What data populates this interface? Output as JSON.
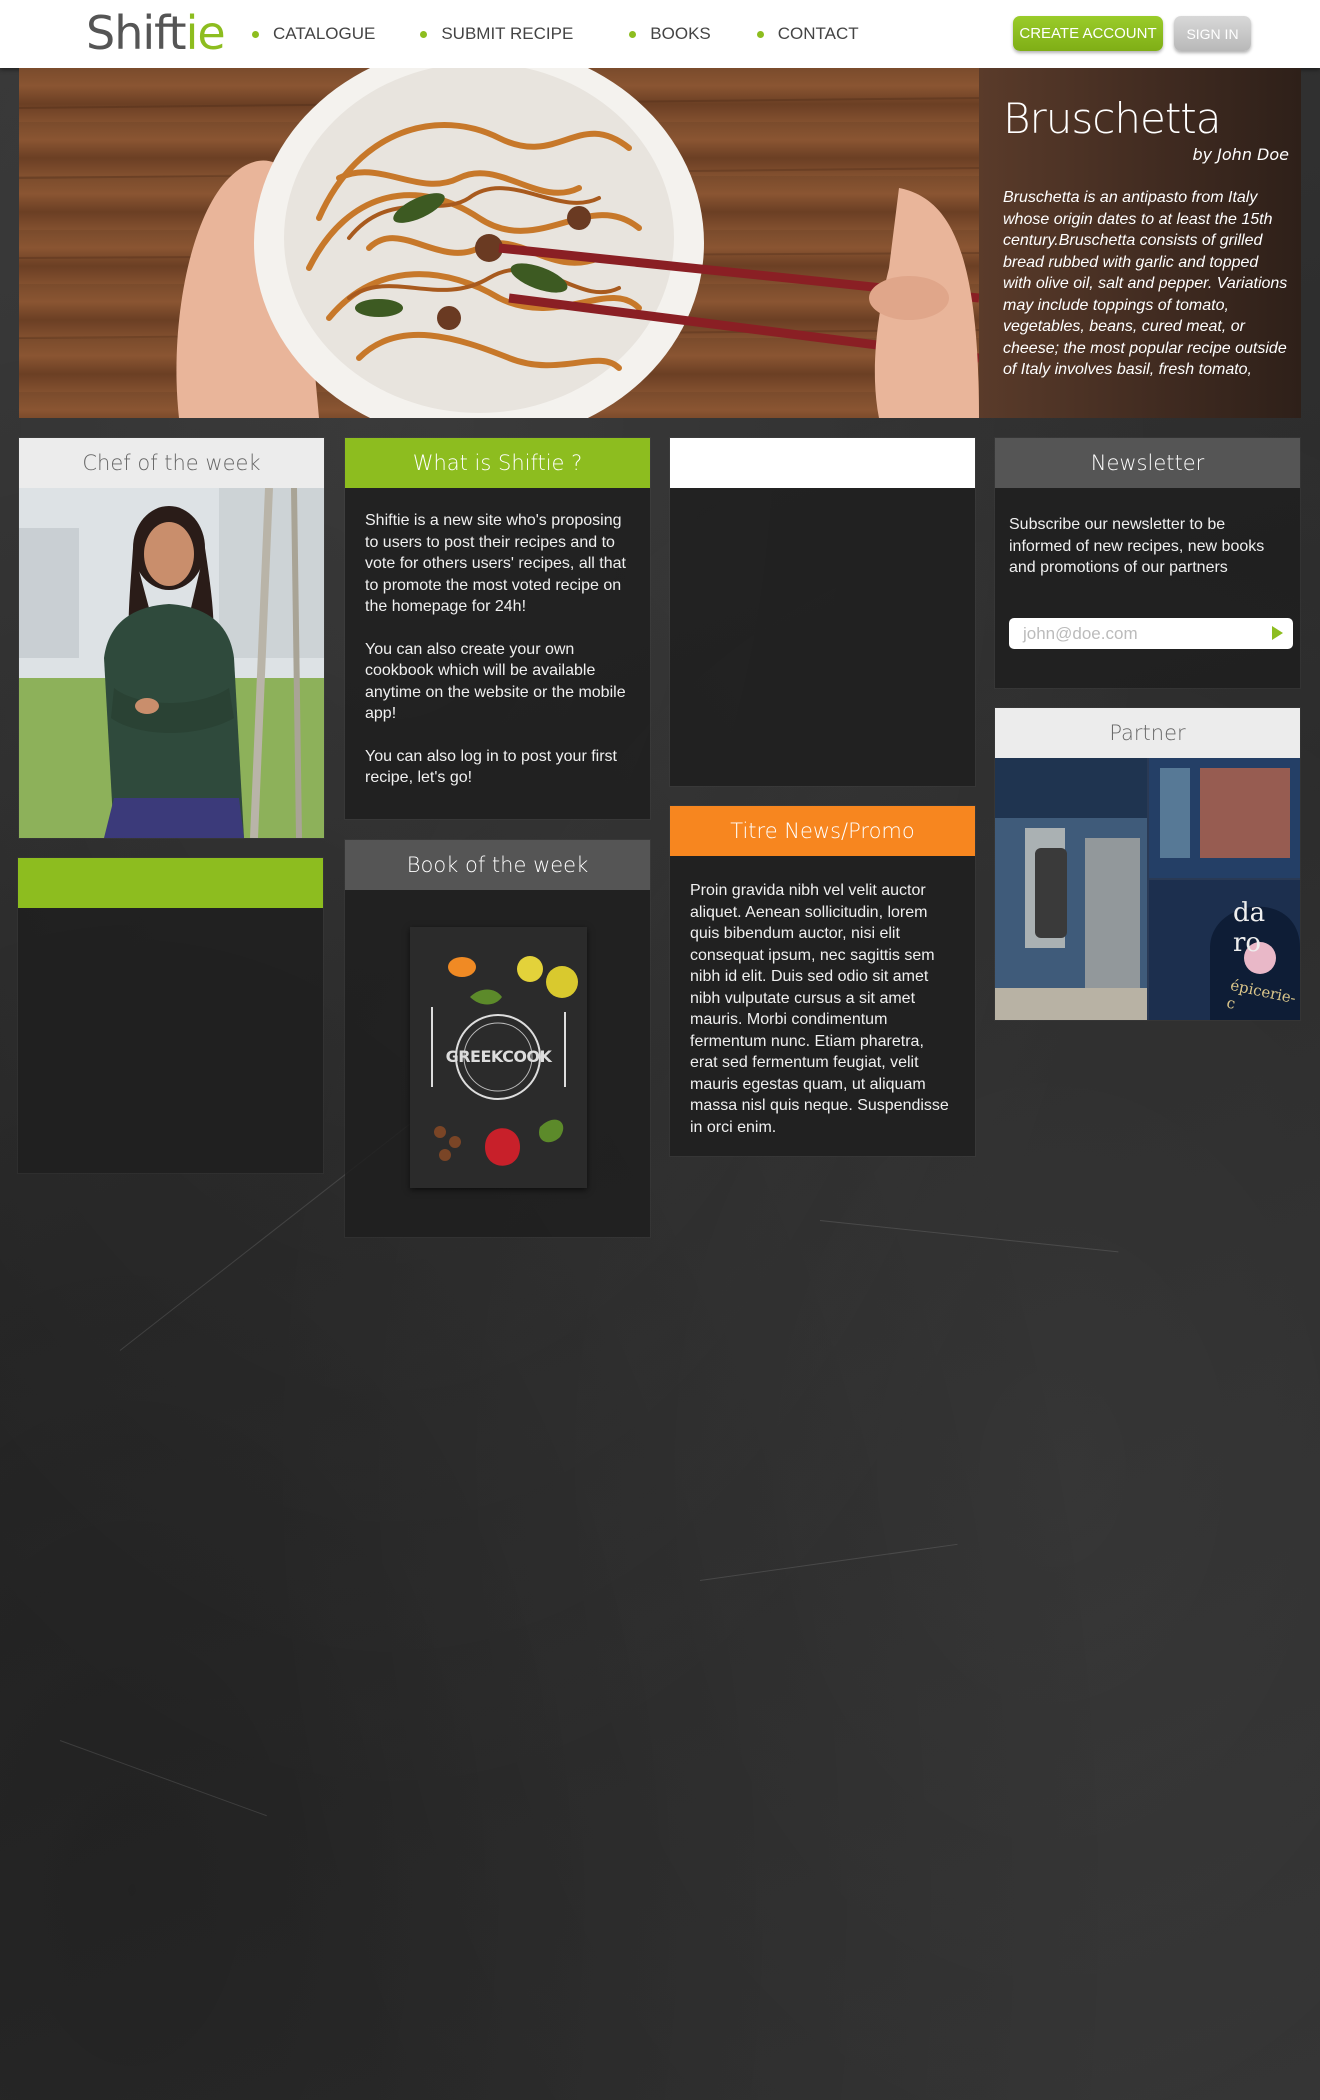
{
  "header": {
    "logo_main": "Shift",
    "logo_accent": "ie",
    "nav": [
      {
        "label": "CATALOGUE"
      },
      {
        "label": "SUBMIT RECIPE"
      },
      {
        "label": "BOOKS"
      },
      {
        "label": "CONTACT"
      }
    ],
    "create_account": "CREATE ACCOUNT",
    "sign_in": "SIGN IN"
  },
  "hero": {
    "title": "Bruschetta",
    "author": "by John Doe",
    "description": "Bruschetta is an antipasto from Italy whose origin dates to at least the 15th century.Bruschetta consists of grilled bread rubbed with garlic and topped with olive oil, salt and pepper. Variations may include toppings of tomato, vegetables, beans, cured meat, or cheese; the most popular recipe outside of Italy involves basil, fresh tomato,"
  },
  "chef": {
    "title": "Chef of the week"
  },
  "about": {
    "title": "What is Shiftie ?",
    "paragraphs": [
      "Shiftie is a new site who's proposing to users to post their recipes and to vote for others users' recipes, all that to promote the most voted recipe on the homepage for 24h!",
      "You can also create your own cookbook which will be available anytime on the website or the mobile app!",
      "You can also log in to post your first recipe, let's go!"
    ]
  },
  "book": {
    "title": "Book of the week",
    "cover_title": "GREEKCOOK"
  },
  "promo": {
    "title": "Titre News/Promo",
    "text": "Proin gravida nibh vel velit auctor aliquet. Aenean sollicitudin, lorem quis bibendum auctor, nisi elit consequat ipsum, nec sagittis sem nibh id elit. Duis sed odio sit amet nibh vulputate cursus a sit amet mauris. Morbi condimentum fermentum nunc. Etiam pharetra, erat sed fermentum feugiat, velit mauris egestas quam, ut aliquam massa nisl quis neque. Suspendisse in orci enim."
  },
  "newsletter": {
    "title": "Newsletter",
    "text": "Subscribe our newsletter to be informed of new recipes, new books and promotions of our partners",
    "placeholder": "john@doe.com"
  },
  "partner": {
    "title": "Partner",
    "sign_text": "da ro",
    "sign_sub": "épicerie-c"
  },
  "colors": {
    "green": "#8dbd1f",
    "orange": "#f7861f",
    "gray_head": "#555555",
    "light_head": "#ececec"
  }
}
